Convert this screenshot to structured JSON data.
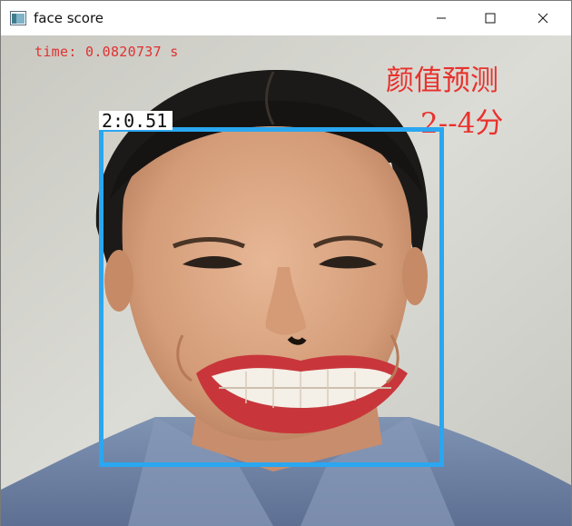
{
  "window": {
    "title": "face score"
  },
  "controls": {
    "minimize_icon": "minimize-icon",
    "maximize_icon": "maximize-icon",
    "close_icon": "close-icon"
  },
  "overlay": {
    "time_text": "time: 0.0820737 s",
    "score_title": "颜值预测",
    "score_range": "2--4分",
    "detection_label": "2:0.51"
  },
  "colors": {
    "box": "#2aa7f0",
    "overlay_text": "#e8322e"
  }
}
